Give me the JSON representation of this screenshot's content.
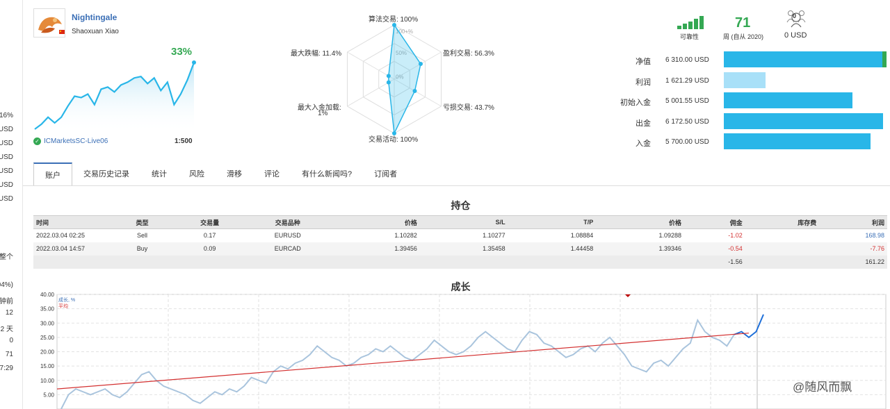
{
  "sidebar_fragments": [
    ".16%",
    "USD",
    "USD",
    "USD",
    "USD",
    "USD",
    "USD",
    "整个",
    "04%)",
    "钟前",
    "12",
    "2 天",
    "0",
    "71",
    "7:29"
  ],
  "profile": {
    "name": "Nightingale",
    "author": "Shaoxuan Xiao",
    "growth_pct": "33%",
    "broker": "ICMarketsSC-Live06",
    "leverage": "1:500"
  },
  "mini_growth_series": [
    5,
    12,
    22,
    14,
    22,
    38,
    52,
    50,
    55,
    40,
    62,
    65,
    58,
    68,
    72,
    78,
    80,
    70,
    78,
    60,
    72,
    40,
    55,
    75,
    100
  ],
  "radar": {
    "scale_labels": [
      "100+%",
      "50%",
      "0%"
    ],
    "axes": [
      {
        "label": "算法交易: 100%",
        "value": 1.0
      },
      {
        "label": "盈利交易: 56.3%",
        "value": 0.563
      },
      {
        "label": "亏损交易: 43.7%",
        "value": 0.437
      },
      {
        "label": "交易活动: 100%",
        "value": 1.0
      },
      {
        "label": "最大入金加载:",
        "label2": "1%",
        "value": 0.01
      },
      {
        "label": "最大跌幅: 11.4%",
        "value": 0.114
      }
    ]
  },
  "summary": {
    "reliability_label": "可靠性",
    "weeks_value": "71",
    "weeks_label": "周 (自从 2020)",
    "subscribers_count": "0",
    "subscription_value": "0 USD"
  },
  "finance": [
    {
      "label": "净值",
      "value": "6 310.00 USD",
      "amount": 6310.0,
      "color": "#29b6e8"
    },
    {
      "label": "利润",
      "value": "1 621.29 USD",
      "amount": 1621.29,
      "color": "#a8e0f8"
    },
    {
      "label": "初始入金",
      "value": "5 001.55 USD",
      "amount": 5001.55,
      "color": "#29b6e8"
    },
    {
      "label": "出金",
      "value": "6 172.50 USD",
      "amount": 6172.5,
      "color": "#29b6e8"
    },
    {
      "label": "入金",
      "value": "5 700.00 USD",
      "amount": 5700.0,
      "color": "#29b6e8"
    }
  ],
  "tabs": [
    "账户",
    "交易历史记录",
    "统计",
    "风险",
    "滑移",
    "评论",
    "有什么新闻吗?",
    "订阅者"
  ],
  "positions": {
    "title": "持仓",
    "headers": [
      "时间",
      "类型",
      "交易量",
      "交易品种",
      "价格",
      "S/L",
      "T/P",
      "价格",
      "佣金",
      "库存费",
      "利润"
    ],
    "rows": [
      [
        "2022.03.04 02:25",
        "Sell",
        "0.17",
        "EURUSD",
        "1.10282",
        "1.10277",
        "1.08884",
        "1.09288",
        "-1.02",
        "",
        "168.98"
      ],
      [
        "2022.03.04 14:57",
        "Buy",
        "0.09",
        "EURCAD",
        "1.39456",
        "1.35458",
        "1.44458",
        "1.39346",
        "-0.54",
        "",
        "-7.76"
      ]
    ],
    "totals": [
      "",
      "",
      "",
      "",
      "",
      "",
      "",
      "",
      "-1.56",
      "",
      "161.22"
    ]
  },
  "growth": {
    "title": "成长",
    "legend": [
      {
        "name": "成长, %",
        "color": "#3b6fb6"
      },
      {
        "name": "平均",
        "color": "#d32f2f"
      }
    ]
  },
  "chart_data": {
    "type": "line",
    "title": "成长",
    "ylim": [
      0,
      40
    ],
    "yticks": [
      "40.00",
      "35.00",
      "30.00",
      "25.00",
      "20.00",
      "15.00",
      "10.00",
      "5.00"
    ],
    "grid": true,
    "series": [
      {
        "name": "成长, %",
        "values": [
          0,
          5,
          7,
          6,
          5,
          6,
          7,
          5,
          4,
          6,
          9,
          12,
          13,
          10,
          8,
          7,
          6,
          5,
          3,
          2,
          4,
          6,
          5,
          7,
          6,
          8,
          11,
          10,
          9,
          13,
          15,
          14,
          16,
          17,
          19,
          22,
          20,
          18,
          17,
          15,
          16,
          18,
          19,
          21,
          20,
          22,
          20,
          18,
          17,
          19,
          21,
          24,
          22,
          20,
          19,
          20,
          22,
          25,
          27,
          25,
          23,
          21,
          20,
          24,
          27,
          26,
          23,
          22,
          20,
          18,
          19,
          21,
          22,
          20,
          23,
          25,
          22,
          19,
          15,
          14,
          13,
          16,
          17,
          15,
          18,
          21,
          23,
          31,
          27,
          25,
          24,
          22,
          26,
          27,
          25,
          27,
          33
        ]
      },
      {
        "name": "平均",
        "values": [
          7,
          26.5
        ]
      }
    ]
  },
  "watermark": "@随风而飘"
}
